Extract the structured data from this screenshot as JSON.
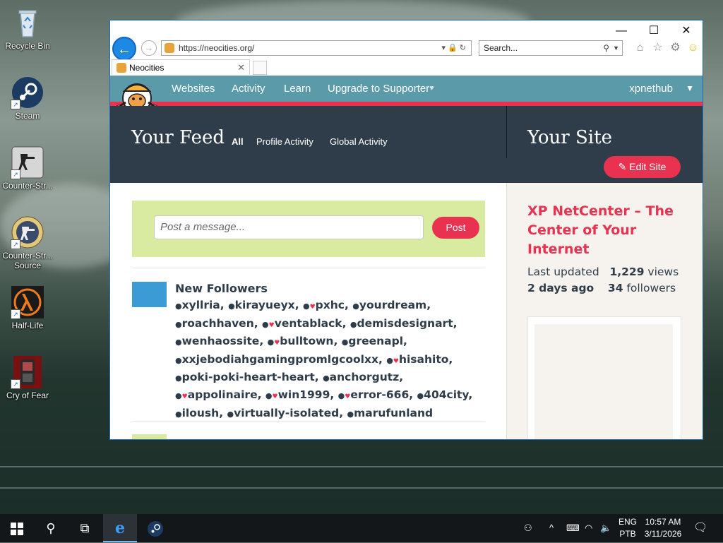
{
  "desktop": {
    "icons": [
      {
        "label": "Recycle Bin"
      },
      {
        "label": "Steam"
      },
      {
        "label": "Counter-Str..."
      },
      {
        "label": "Counter-Str... Source"
      },
      {
        "label": "Half-Life"
      },
      {
        "label": "Cry of Fear"
      }
    ]
  },
  "browser": {
    "url": "https://neocities.org/",
    "search_placeholder": "Search...",
    "tab_title": "Neocities"
  },
  "site": {
    "nav": {
      "items": [
        "Websites",
        "Activity",
        "Learn",
        "Upgrade to Supporter"
      ],
      "supporter_heart": "♥",
      "user": "xpnethub"
    },
    "feed": {
      "title": "Your Feed",
      "filters": [
        "All",
        "Profile Activity",
        "Global Activity"
      ]
    },
    "your_site": {
      "title": "Your Site",
      "edit_button": "Edit Site",
      "name": "XP NetCenter – The Center of Your Internet",
      "last_updated_label": "Last updated",
      "last_updated_value": "2 days ago",
      "views_count": "1,229",
      "views_label": "views",
      "followers_count": "34",
      "followers_label": "followers"
    },
    "composer": {
      "placeholder": "Post a message...",
      "post_button": "Post"
    },
    "event": {
      "title": "New Followers",
      "followers": [
        {
          "name": "xyllria",
          "supporter": false
        },
        {
          "name": "kirayueyx",
          "supporter": false
        },
        {
          "name": "pxhc",
          "supporter": true
        },
        {
          "name": "yourdream",
          "supporter": false
        },
        {
          "name": "roachhaven",
          "supporter": false
        },
        {
          "name": "ventablack",
          "supporter": true
        },
        {
          "name": "demisdesignart",
          "supporter": false
        },
        {
          "name": "wenhaossite",
          "supporter": false
        },
        {
          "name": "bulltown",
          "supporter": true
        },
        {
          "name": "greenapl",
          "supporter": false
        },
        {
          "name": "xxjebodiahgamingpromlgcoolxx",
          "supporter": false
        },
        {
          "name": "hisahito",
          "supporter": true
        },
        {
          "name": "poki-poki-heart-heart",
          "supporter": false
        },
        {
          "name": "anchorgutz",
          "supporter": false
        },
        {
          "name": "appolinaire",
          "supporter": true
        },
        {
          "name": "win1999",
          "supporter": true
        },
        {
          "name": "error-666",
          "supporter": true
        },
        {
          "name": "404city",
          "supporter": false
        },
        {
          "name": "iloush",
          "supporter": false
        },
        {
          "name": "virtually-isolated",
          "supporter": false
        },
        {
          "name": "marufunland",
          "supporter": false
        }
      ]
    }
  },
  "taskbar": {
    "lang_top": "ENG",
    "lang_bottom": "PTB",
    "time": "10:57 AM",
    "date": "3/11/2026"
  },
  "colors": {
    "accent": "#e93250",
    "nav_bg": "#5b9aa8",
    "hero_bg": "#2e3d49",
    "composer_bg": "#d9eba1"
  }
}
